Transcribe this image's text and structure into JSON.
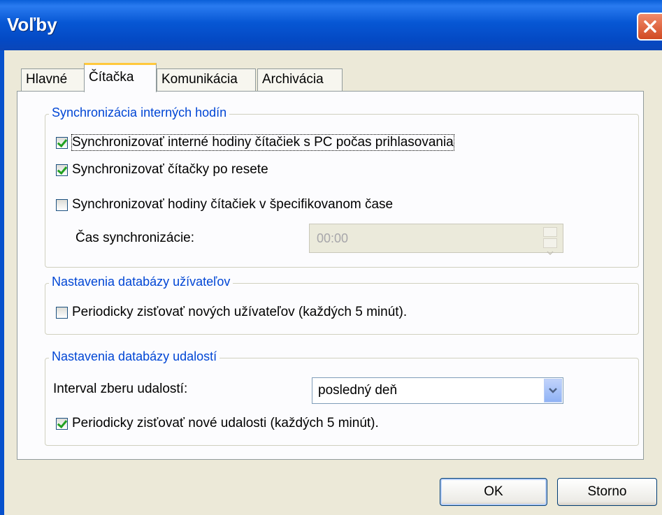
{
  "window": {
    "title": "Voľby",
    "close_icon": "close-icon"
  },
  "tabs": [
    {
      "label": "Hlavné",
      "active": false
    },
    {
      "label": "Čítačka",
      "active": true
    },
    {
      "label": "Komunikácia",
      "active": false
    },
    {
      "label": "Archivácia",
      "active": false
    }
  ],
  "sync_group": {
    "legend": "Synchronizácia interných hodín",
    "cb_login": {
      "label": "Synchronizovať interné hodiny čítačiek s PC počas prihlasovania",
      "checked": true
    },
    "cb_reset": {
      "label": "Synchronizovať čítačky po resete",
      "checked": true
    },
    "cb_time": {
      "label": "Synchronizovať hodiny čítačiek v špecifikovanom čase",
      "checked": false
    },
    "time_label": "Čas synchronizácie:",
    "time_value": "00:00"
  },
  "users_group": {
    "legend": "Nastavenia databázy užívateľov",
    "cb_users": {
      "label": "Periodicky zisťovať nových užívateľov (každých 5 minút).",
      "checked": false
    }
  },
  "events_group": {
    "legend": "Nastavenia databázy udalostí",
    "interval_label": "Interval zberu udalostí:",
    "interval_value": "posledný deň",
    "cb_events": {
      "label": "Periodicky zisťovať nové udalosti (každých 5 minút).",
      "checked": true
    }
  },
  "buttons": {
    "ok": "OK",
    "cancel": "Storno"
  },
  "colors": {
    "titlebar": "#0757d4",
    "group_legend": "#0046d5",
    "checkmark": "#21a121",
    "tab_highlight": "#ffc83c"
  }
}
